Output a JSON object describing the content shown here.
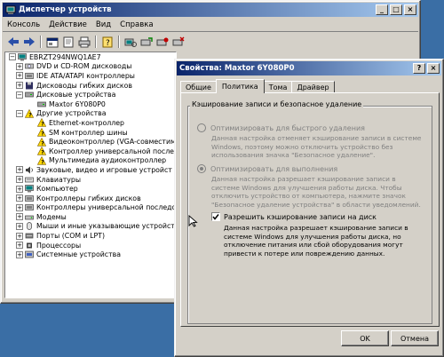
{
  "devmgr": {
    "title": "Диспетчер устройств",
    "menu": [
      "Консоль",
      "Действие",
      "Вид",
      "Справка"
    ],
    "tree": [
      {
        "label": "EBRZT294NWQ1AE7",
        "level": 0,
        "expander": "−",
        "icon": "computer-icon"
      },
      {
        "label": "DVD и CD-ROM дисководы",
        "level": 1,
        "expander": "+",
        "icon": "cdrom-icon"
      },
      {
        "label": "IDE ATA/ATAPI контроллеры",
        "level": 1,
        "expander": "+",
        "icon": "ide-icon"
      },
      {
        "label": "Дисководы гибких дисков",
        "level": 1,
        "expander": "+",
        "icon": "floppy-icon"
      },
      {
        "label": "Дисковые устройства",
        "level": 1,
        "expander": "−",
        "icon": "disk-icon"
      },
      {
        "label": "Maxtor 6Y080P0",
        "level": 2,
        "expander": "",
        "icon": "disk-icon"
      },
      {
        "label": "Другие устройства",
        "level": 1,
        "expander": "−",
        "icon": "warning-icon"
      },
      {
        "label": "Ethernet-контроллер",
        "level": 2,
        "expander": "",
        "icon": "warning-icon"
      },
      {
        "label": "SM контроллер шины",
        "level": 2,
        "expander": "",
        "icon": "warning-icon"
      },
      {
        "label": "Видеоконтроллер (VGA-совместим",
        "level": 2,
        "expander": "",
        "icon": "warning-icon"
      },
      {
        "label": "Контроллер универсальной послед",
        "level": 2,
        "expander": "",
        "icon": "warning-icon"
      },
      {
        "label": "Мультимедиа аудиоконтроллер",
        "level": 2,
        "expander": "",
        "icon": "warning-icon"
      },
      {
        "label": "Звуковые, видео и игровые устройст",
        "level": 1,
        "expander": "+",
        "icon": "sound-icon"
      },
      {
        "label": "Клавиатуры",
        "level": 1,
        "expander": "+",
        "icon": "keyboard-icon"
      },
      {
        "label": "Компьютер",
        "level": 1,
        "expander": "+",
        "icon": "computer-icon"
      },
      {
        "label": "Контроллеры гибких дисков",
        "level": 1,
        "expander": "+",
        "icon": "controller-icon"
      },
      {
        "label": "Контроллеры универсальной последо",
        "level": 1,
        "expander": "+",
        "icon": "usb-icon"
      },
      {
        "label": "Модемы",
        "level": 1,
        "expander": "+",
        "icon": "modem-icon"
      },
      {
        "label": "Мыши и иные указывающие устройст",
        "level": 1,
        "expander": "+",
        "icon": "mouse-icon"
      },
      {
        "label": "Порты (COM и LPT)",
        "level": 1,
        "expander": "+",
        "icon": "port-icon"
      },
      {
        "label": "Процессоры",
        "level": 1,
        "expander": "+",
        "icon": "cpu-icon"
      },
      {
        "label": "Системные устройства",
        "level": 1,
        "expander": "+",
        "icon": "system-icon"
      }
    ]
  },
  "props": {
    "title": "Свойства: Maxtor 6Y080P0",
    "help_btn": "?",
    "close_btn": "×",
    "tabs": [
      "Общие",
      "Политика",
      "Тома",
      "Драйвер"
    ],
    "active_tab": "Политика",
    "group_label": "Кэширование записи и безопасное удаление",
    "radio1_label": "Оптимизировать для быстрого удаления",
    "radio1_desc": "Данная настройка отменяет кэширование записи в системе Windows, поэтому можно отключить устройство без использования значка \"Безопасное удаление\".",
    "radio2_label": "Оптимизировать для выполнения",
    "radio2_desc": "Данная настройка разрешает кэширование записи в системе Windows для улучшения работы диска. Чтобы отключить устройство от компьютера, нажмите значок \"Безопасное удаление устройства\" в области уведомлений.",
    "checkbox_label": "Разрешить кэширование записи на диск",
    "checkbox_desc": "Данная настройка разрешает кэширование записи в системе Windows для улучшения работы диска, но отключение питания или сбой оборудования могут привести к потере или повреждению данных.",
    "ok_label": "OK",
    "cancel_label": "Отмена"
  }
}
